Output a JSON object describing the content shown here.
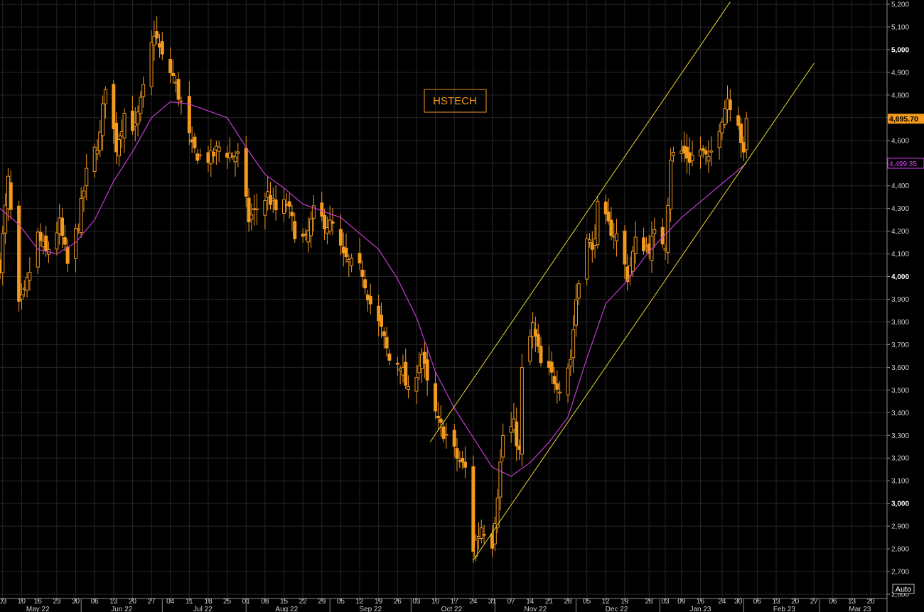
{
  "chart_data": {
    "type": "candlestick",
    "title": "HSTECH",
    "ylim": [
      2600,
      5200
    ],
    "y_ticks": [
      2600,
      2700,
      2800,
      2900,
      3000,
      3100,
      3200,
      3300,
      3400,
      3500,
      3600,
      3700,
      3800,
      3900,
      4000,
      4100,
      4200,
      4300,
      4400,
      4500,
      4600,
      4700,
      4800,
      4900,
      5000,
      5100,
      5200
    ],
    "y_tick_labels": [
      "2,600",
      "2,700",
      "2,800",
      "2,900",
      "3,000",
      "3,100",
      "3,200",
      "3,300",
      "3,400",
      "3,500",
      "3,600",
      "3,700",
      "3,800",
      "3,900",
      "4,000",
      "4,100",
      "4,200",
      "4,300",
      "4,400",
      "4,500",
      "4,600",
      "4,700",
      "4,800",
      "4,900",
      "5,000",
      "5,100",
      "5,200"
    ],
    "y_major_ticks": [
      3000,
      4000,
      5000
    ],
    "x_range": [
      "2022-05-02",
      "2023-03-26"
    ],
    "x_day_ticks": [
      {
        "date": "2022-05-03",
        "label": "03"
      },
      {
        "date": "2022-05-10",
        "label": "10"
      },
      {
        "date": "2022-05-16",
        "label": "16"
      },
      {
        "date": "2022-05-23",
        "label": "23"
      },
      {
        "date": "2022-05-30",
        "label": "30"
      },
      {
        "date": "2022-06-06",
        "label": "06"
      },
      {
        "date": "2022-06-13",
        "label": "13"
      },
      {
        "date": "2022-06-20",
        "label": "20"
      },
      {
        "date": "2022-06-27",
        "label": "27"
      },
      {
        "date": "2022-07-04",
        "label": "04"
      },
      {
        "date": "2022-07-11",
        "label": "11"
      },
      {
        "date": "2022-07-18",
        "label": "18"
      },
      {
        "date": "2022-07-25",
        "label": "25"
      },
      {
        "date": "2022-08-01",
        "label": "01"
      },
      {
        "date": "2022-08-08",
        "label": "08"
      },
      {
        "date": "2022-08-15",
        "label": "15"
      },
      {
        "date": "2022-08-22",
        "label": "22"
      },
      {
        "date": "2022-08-29",
        "label": "29"
      },
      {
        "date": "2022-09-05",
        "label": "05"
      },
      {
        "date": "2022-09-12",
        "label": "12"
      },
      {
        "date": "2022-09-19",
        "label": "19"
      },
      {
        "date": "2022-09-26",
        "label": "26"
      },
      {
        "date": "2022-10-03",
        "label": "03"
      },
      {
        "date": "2022-10-10",
        "label": "10"
      },
      {
        "date": "2022-10-17",
        "label": "17"
      },
      {
        "date": "2022-10-24",
        "label": "24"
      },
      {
        "date": "2022-10-31",
        "label": "31"
      },
      {
        "date": "2022-11-07",
        "label": "07"
      },
      {
        "date": "2022-11-14",
        "label": "14"
      },
      {
        "date": "2022-11-21",
        "label": "21"
      },
      {
        "date": "2022-11-28",
        "label": "28"
      },
      {
        "date": "2022-12-05",
        "label": "05"
      },
      {
        "date": "2022-12-12",
        "label": "12"
      },
      {
        "date": "2022-12-19",
        "label": "19"
      },
      {
        "date": "2022-12-28",
        "label": "28"
      },
      {
        "date": "2023-01-03",
        "label": "03"
      },
      {
        "date": "2023-01-09",
        "label": "09"
      },
      {
        "date": "2023-01-16",
        "label": "16"
      },
      {
        "date": "2023-01-24",
        "label": "24"
      },
      {
        "date": "2023-01-30",
        "label": "30"
      },
      {
        "date": "2023-02-06",
        "label": "06"
      },
      {
        "date": "2023-02-13",
        "label": "13"
      },
      {
        "date": "2023-02-20",
        "label": "20"
      },
      {
        "date": "2023-02-27",
        "label": "27"
      },
      {
        "date": "2023-03-06",
        "label": "06"
      },
      {
        "date": "2023-03-13",
        "label": "13"
      },
      {
        "date": "2023-03-20",
        "label": "20"
      }
    ],
    "x_month_ticks": [
      {
        "date": "2022-05-16",
        "label": "May 22"
      },
      {
        "date": "2022-06-16",
        "label": "Jun 22"
      },
      {
        "date": "2022-07-16",
        "label": "Jul 22"
      },
      {
        "date": "2022-08-16",
        "label": "Aug 22"
      },
      {
        "date": "2022-09-16",
        "label": "Sep 22"
      },
      {
        "date": "2022-10-16",
        "label": "Oct 22"
      },
      {
        "date": "2022-11-16",
        "label": "Nov 22"
      },
      {
        "date": "2022-12-16",
        "label": "Dec 22"
      },
      {
        "date": "2023-01-16",
        "label": "Jan 23"
      },
      {
        "date": "2023-02-16",
        "label": "Feb 23"
      },
      {
        "date": "2023-03-16",
        "label": "Mar 23"
      }
    ],
    "x_month_boundaries": [
      "2022-06-01",
      "2022-07-01",
      "2022-08-01",
      "2022-09-01",
      "2022-10-01",
      "2022-11-01",
      "2022-12-01",
      "2023-01-01",
      "2023-02-01",
      "2023-03-01"
    ],
    "last_price": 4695.7,
    "last_price_label": "4,695.70",
    "ma_last": 4499.35,
    "ma_last_label": "4,499.35",
    "auto_label": "Auto",
    "colors": {
      "background": "#000000",
      "grid": "#262626",
      "candle": "#f39a1e",
      "moving_average": "#c63bd6",
      "channel": "#e6d832",
      "price_tag_bg": "#f39a1e",
      "ma_tag": "#e040fb"
    },
    "candle_anchors": [
      {
        "date": "2022-05-02",
        "close": 4050
      },
      {
        "date": "2022-05-05",
        "close": 4420
      },
      {
        "date": "2022-05-09",
        "close": 3860
      },
      {
        "date": "2022-05-11",
        "close": 3920
      },
      {
        "date": "2022-05-16",
        "close": 4180
      },
      {
        "date": "2022-05-19",
        "close": 4100
      },
      {
        "date": "2022-05-24",
        "close": 4230
      },
      {
        "date": "2022-05-27",
        "close": 4050
      },
      {
        "date": "2022-05-31",
        "close": 4240
      },
      {
        "date": "2022-06-03",
        "close": 4450
      },
      {
        "date": "2022-06-08",
        "close": 4620
      },
      {
        "date": "2022-06-10",
        "close": 4850
      },
      {
        "date": "2022-06-14",
        "close": 4570
      },
      {
        "date": "2022-06-17",
        "close": 4720
      },
      {
        "date": "2022-06-21",
        "close": 4650
      },
      {
        "date": "2022-06-24",
        "close": 4820
      },
      {
        "date": "2022-06-28",
        "close": 5080
      },
      {
        "date": "2022-07-01",
        "close": 4960
      },
      {
        "date": "2022-07-05",
        "close": 4880
      },
      {
        "date": "2022-07-08",
        "close": 4760
      },
      {
        "date": "2022-07-12",
        "close": 4560
      },
      {
        "date": "2022-07-15",
        "close": 4530
      },
      {
        "date": "2022-07-19",
        "close": 4520
      },
      {
        "date": "2022-07-22",
        "close": 4570
      },
      {
        "date": "2022-07-26",
        "close": 4540
      },
      {
        "date": "2022-07-29",
        "close": 4530
      },
      {
        "date": "2022-08-02",
        "close": 4250
      },
      {
        "date": "2022-08-05",
        "close": 4300
      },
      {
        "date": "2022-08-09",
        "close": 4360
      },
      {
        "date": "2022-08-12",
        "close": 4290
      },
      {
        "date": "2022-08-16",
        "close": 4320
      },
      {
        "date": "2022-08-19",
        "close": 4200
      },
      {
        "date": "2022-08-23",
        "close": 4150
      },
      {
        "date": "2022-08-26",
        "close": 4280
      },
      {
        "date": "2022-08-30",
        "close": 4240
      },
      {
        "date": "2022-09-02",
        "close": 4220
      },
      {
        "date": "2022-09-06",
        "close": 4080
      },
      {
        "date": "2022-09-09",
        "close": 4050
      },
      {
        "date": "2022-09-13",
        "close": 4020
      },
      {
        "date": "2022-09-16",
        "close": 3880
      },
      {
        "date": "2022-09-20",
        "close": 3760
      },
      {
        "date": "2022-09-23",
        "close": 3630
      },
      {
        "date": "2022-09-27",
        "close": 3620
      },
      {
        "date": "2022-09-30",
        "close": 3480
      },
      {
        "date": "2022-10-05",
        "close": 3660
      },
      {
        "date": "2022-10-07",
        "close": 3520
      },
      {
        "date": "2022-10-11",
        "close": 3350
      },
      {
        "date": "2022-10-14",
        "close": 3300
      },
      {
        "date": "2022-10-18",
        "close": 3200
      },
      {
        "date": "2022-10-21",
        "close": 3150
      },
      {
        "date": "2022-10-24",
        "close": 2800
      },
      {
        "date": "2022-10-27",
        "close": 2900
      },
      {
        "date": "2022-10-31",
        "close": 2830
      },
      {
        "date": "2022-11-02",
        "close": 3050
      },
      {
        "date": "2022-11-04",
        "close": 3300
      },
      {
        "date": "2022-11-08",
        "close": 3340
      },
      {
        "date": "2022-11-10",
        "close": 3220
      },
      {
        "date": "2022-11-11",
        "close": 3580
      },
      {
        "date": "2022-11-15",
        "close": 3780
      },
      {
        "date": "2022-11-18",
        "close": 3610
      },
      {
        "date": "2022-11-22",
        "close": 3560
      },
      {
        "date": "2022-11-25",
        "close": 3520
      },
      {
        "date": "2022-11-29",
        "close": 3640
      },
      {
        "date": "2022-12-01",
        "close": 3900
      },
      {
        "date": "2022-12-05",
        "close": 4200
      },
      {
        "date": "2022-12-07",
        "close": 4100
      },
      {
        "date": "2022-12-09",
        "close": 4300
      },
      {
        "date": "2022-12-13",
        "close": 4220
      },
      {
        "date": "2022-12-16",
        "close": 4180
      },
      {
        "date": "2022-12-20",
        "close": 4000
      },
      {
        "date": "2022-12-23",
        "close": 4150
      },
      {
        "date": "2022-12-28",
        "close": 4130
      },
      {
        "date": "2022-12-30",
        "close": 4180
      },
      {
        "date": "2023-01-03",
        "close": 4150
      },
      {
        "date": "2023-01-05",
        "close": 4530
      },
      {
        "date": "2023-01-09",
        "close": 4550
      },
      {
        "date": "2023-01-12",
        "close": 4520
      },
      {
        "date": "2023-01-16",
        "close": 4560
      },
      {
        "date": "2023-01-19",
        "close": 4500
      },
      {
        "date": "2023-01-20",
        "close": 4550
      },
      {
        "date": "2023-01-26",
        "close": 4790
      },
      {
        "date": "2023-01-30",
        "close": 4690
      },
      {
        "date": "2023-02-01",
        "close": 4520
      },
      {
        "date": "2023-02-02",
        "close": 4695.7
      }
    ],
    "moving_average": [
      {
        "date": "2022-05-02",
        "value": 4300
      },
      {
        "date": "2022-05-09",
        "value": 4230
      },
      {
        "date": "2022-05-16",
        "value": 4120
      },
      {
        "date": "2022-05-23",
        "value": 4100
      },
      {
        "date": "2022-05-30",
        "value": 4150
      },
      {
        "date": "2022-06-06",
        "value": 4250
      },
      {
        "date": "2022-06-13",
        "value": 4420
      },
      {
        "date": "2022-06-20",
        "value": 4550
      },
      {
        "date": "2022-06-27",
        "value": 4700
      },
      {
        "date": "2022-07-04",
        "value": 4770
      },
      {
        "date": "2022-07-11",
        "value": 4760
      },
      {
        "date": "2022-07-18",
        "value": 4730
      },
      {
        "date": "2022-07-25",
        "value": 4700
      },
      {
        "date": "2022-08-01",
        "value": 4570
      },
      {
        "date": "2022-08-08",
        "value": 4450
      },
      {
        "date": "2022-08-15",
        "value": 4390
      },
      {
        "date": "2022-08-22",
        "value": 4320
      },
      {
        "date": "2022-08-29",
        "value": 4290
      },
      {
        "date": "2022-09-05",
        "value": 4260
      },
      {
        "date": "2022-09-12",
        "value": 4190
      },
      {
        "date": "2022-09-19",
        "value": 4120
      },
      {
        "date": "2022-09-26",
        "value": 3990
      },
      {
        "date": "2022-10-03",
        "value": 3820
      },
      {
        "date": "2022-10-10",
        "value": 3580
      },
      {
        "date": "2022-10-17",
        "value": 3420
      },
      {
        "date": "2022-10-24",
        "value": 3290
      },
      {
        "date": "2022-10-31",
        "value": 3160
      },
      {
        "date": "2022-11-07",
        "value": 3120
      },
      {
        "date": "2022-11-14",
        "value": 3180
      },
      {
        "date": "2022-11-21",
        "value": 3270
      },
      {
        "date": "2022-11-28",
        "value": 3380
      },
      {
        "date": "2022-12-05",
        "value": 3640
      },
      {
        "date": "2022-12-12",
        "value": 3880
      },
      {
        "date": "2022-12-19",
        "value": 3970
      },
      {
        "date": "2022-12-28",
        "value": 4110
      },
      {
        "date": "2023-01-09",
        "value": 4260
      },
      {
        "date": "2023-01-16",
        "value": 4330
      },
      {
        "date": "2023-01-24",
        "value": 4410
      },
      {
        "date": "2023-02-02",
        "value": 4499.35
      }
    ],
    "channel_lines": [
      {
        "start": {
          "date": "2022-10-08",
          "value": 3270
        },
        "end": {
          "date": "2023-01-27",
          "value": 5210
        }
      },
      {
        "start": {
          "date": "2022-10-24",
          "value": 2750
        },
        "end": {
          "date": "2023-02-27",
          "value": 4940
        }
      }
    ]
  }
}
